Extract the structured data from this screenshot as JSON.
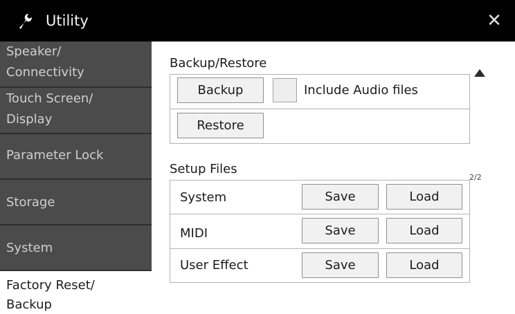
{
  "window": {
    "title": "Utility",
    "close_glyph": "✕"
  },
  "sidebar": {
    "items": [
      {
        "line1": "Speaker/",
        "line2": "Connectivity",
        "active": false
      },
      {
        "line1": "Touch Screen/",
        "line2": "Display",
        "active": false
      },
      {
        "label": "Parameter Lock",
        "active": false
      },
      {
        "label": "Storage",
        "active": false
      },
      {
        "label": "System",
        "active": false
      },
      {
        "line1": "Factory Reset/",
        "line2": "Backup",
        "active": true
      }
    ]
  },
  "backup_restore": {
    "heading": "Backup/Restore",
    "backup_label": "Backup",
    "include_audio_label": "Include Audio files",
    "include_audio_checked": false,
    "restore_label": "Restore"
  },
  "setup_files": {
    "heading": "Setup Files",
    "rows": [
      {
        "name": "System",
        "save_label": "Save",
        "load_label": "Load"
      },
      {
        "name": "MIDI",
        "save_label": "Save",
        "load_label": "Load"
      },
      {
        "name": "User Effect",
        "save_label": "Save",
        "load_label": "Load"
      }
    ]
  },
  "pager": {
    "page_indicator": "2/2"
  },
  "icons": {
    "title_icon": "wrench-icon",
    "close_icon": "close-icon",
    "scroll_icon": "scroll-up-arrow-icon"
  },
  "colors": {
    "titlebar_bg": "#000000",
    "sidebar_item_bg": "#4b4b4b",
    "sidebar_active_bg": "#ffffff",
    "button_bg": "#f1f1f1",
    "border": "#b3b3b3"
  }
}
